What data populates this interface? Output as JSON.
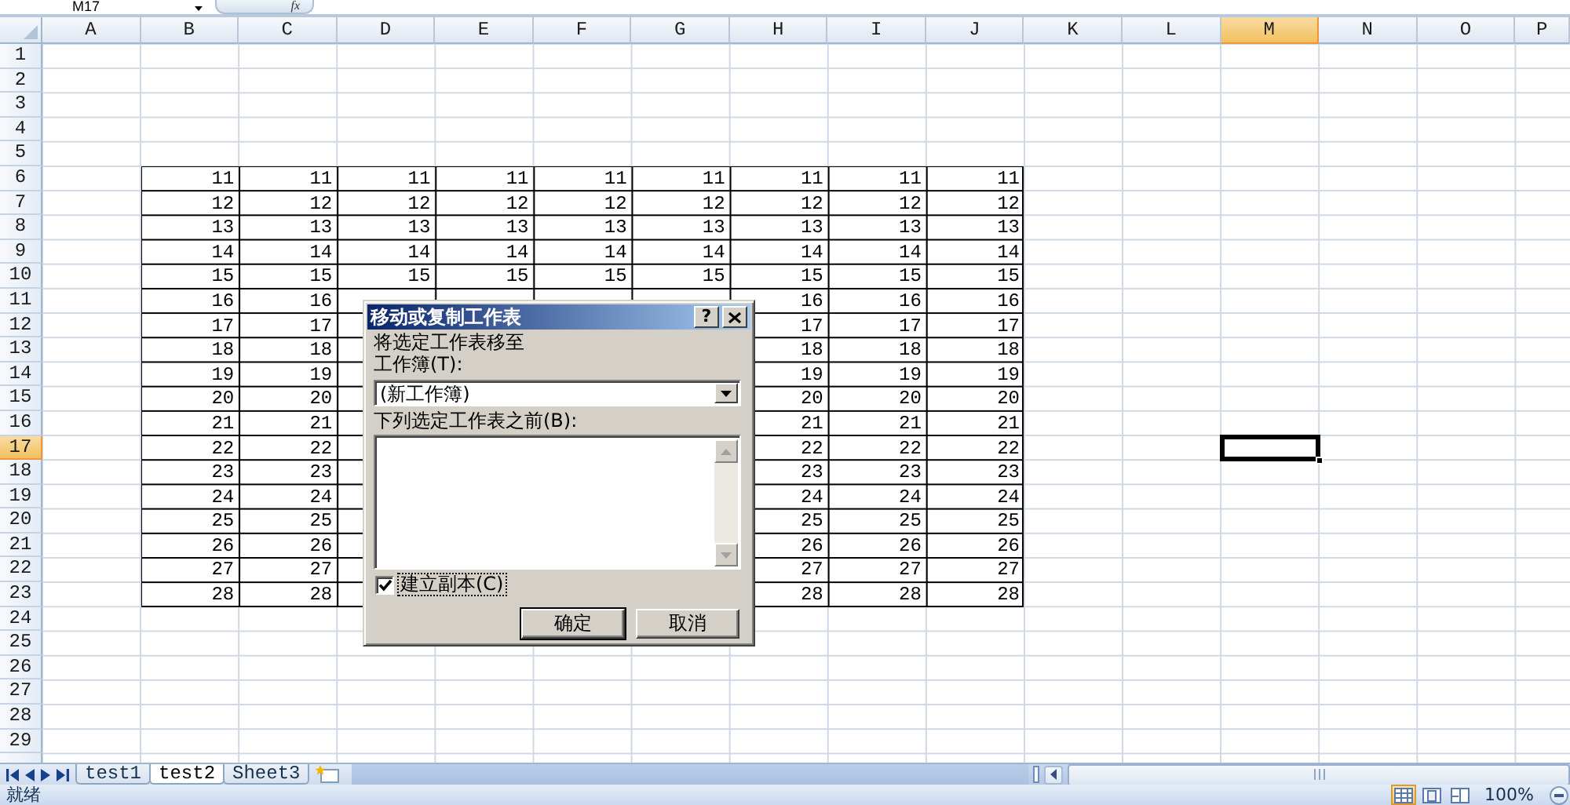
{
  "formula_bar": {
    "name_box": "M17",
    "function_button": "fx"
  },
  "sheet": {
    "columns": [
      {
        "label": "A",
        "selected": false
      },
      {
        "label": "B",
        "selected": false
      },
      {
        "label": "C",
        "selected": false
      },
      {
        "label": "D",
        "selected": false
      },
      {
        "label": "E",
        "selected": false
      },
      {
        "label": "F",
        "selected": false
      },
      {
        "label": "G",
        "selected": false
      },
      {
        "label": "H",
        "selected": false
      },
      {
        "label": "I",
        "selected": false
      },
      {
        "label": "J",
        "selected": false
      },
      {
        "label": "K",
        "selected": false
      },
      {
        "label": "L",
        "selected": false
      },
      {
        "label": "M",
        "selected": true
      },
      {
        "label": "N",
        "selected": false
      },
      {
        "label": "O",
        "selected": false
      },
      {
        "label": "P",
        "selected": false
      }
    ],
    "rows": [
      {
        "label": "1",
        "selected": false
      },
      {
        "label": "2",
        "selected": false
      },
      {
        "label": "3",
        "selected": false
      },
      {
        "label": "4",
        "selected": false
      },
      {
        "label": "5",
        "selected": false
      },
      {
        "label": "6",
        "selected": false,
        "values": [
          "11",
          "11",
          "11",
          "11",
          "11",
          "11",
          "11",
          "11",
          "11"
        ]
      },
      {
        "label": "7",
        "selected": false,
        "values": [
          "12",
          "12",
          "12",
          "12",
          "12",
          "12",
          "12",
          "12",
          "12"
        ]
      },
      {
        "label": "8",
        "selected": false,
        "values": [
          "13",
          "13",
          "13",
          "13",
          "13",
          "13",
          "13",
          "13",
          "13"
        ]
      },
      {
        "label": "9",
        "selected": false,
        "values": [
          "14",
          "14",
          "14",
          "14",
          "14",
          "14",
          "14",
          "14",
          "14"
        ]
      },
      {
        "label": "10",
        "selected": false,
        "values": [
          "15",
          "15",
          "15",
          "15",
          "15",
          "15",
          "15",
          "15",
          "15"
        ]
      },
      {
        "label": "11",
        "selected": false,
        "values": [
          "16",
          "16"
        ],
        "right_values": [
          "16",
          "16",
          "16"
        ]
      },
      {
        "label": "12",
        "selected": false,
        "values": [
          "17",
          "17"
        ],
        "right_values": [
          "17",
          "17",
          "17"
        ]
      },
      {
        "label": "13",
        "selected": false,
        "values": [
          "18",
          "18"
        ],
        "right_values": [
          "18",
          "18",
          "18"
        ]
      },
      {
        "label": "14",
        "selected": false,
        "values": [
          "19",
          "19"
        ],
        "right_values": [
          "19",
          "19",
          "19"
        ]
      },
      {
        "label": "15",
        "selected": false,
        "values": [
          "20",
          "20"
        ],
        "right_values": [
          "20",
          "20",
          "20"
        ]
      },
      {
        "label": "16",
        "selected": false,
        "values": [
          "21",
          "21"
        ],
        "right_values": [
          "21",
          "21",
          "21"
        ]
      },
      {
        "label": "17",
        "selected": true,
        "values": [
          "22",
          "22"
        ],
        "right_values": [
          "22",
          "22",
          "22"
        ]
      },
      {
        "label": "18",
        "selected": false,
        "values": [
          "23",
          "23"
        ],
        "right_values": [
          "23",
          "23",
          "23"
        ]
      },
      {
        "label": "19",
        "selected": false,
        "values": [
          "24",
          "24"
        ],
        "right_values": [
          "24",
          "24",
          "24"
        ]
      },
      {
        "label": "20",
        "selected": false,
        "values": [
          "25",
          "25"
        ],
        "right_values": [
          "25",
          "25",
          "25"
        ]
      },
      {
        "label": "21",
        "selected": false,
        "values": [
          "26",
          "26"
        ],
        "right_values": [
          "26",
          "26",
          "26"
        ]
      },
      {
        "label": "22",
        "selected": false,
        "values": [
          "27",
          "27"
        ],
        "right_values": [
          "27",
          "27",
          "27"
        ]
      },
      {
        "label": "23",
        "selected": false,
        "values": [
          "28",
          "28"
        ],
        "right_values": [
          "28",
          "28",
          "28"
        ]
      },
      {
        "label": "24",
        "selected": false
      },
      {
        "label": "25",
        "selected": false
      },
      {
        "label": "26",
        "selected": false
      },
      {
        "label": "27",
        "selected": false
      },
      {
        "label": "28",
        "selected": false
      },
      {
        "label": "29",
        "selected": false
      }
    ]
  },
  "dialog": {
    "title": "移动或复制工作表",
    "help_button": "?",
    "prompt": "将选定工作表移至",
    "workbook_label": "工作簿(T):",
    "workbook_value": "(新工作簿)",
    "before_label": "下列选定工作表之前(B):",
    "copy_checkbox": {
      "label": "建立副本(C)",
      "checked": true
    },
    "buttons": [
      {
        "label": "确定",
        "default": true
      },
      {
        "label": "取消",
        "default": false
      }
    ]
  },
  "sheet_tabs": [
    {
      "label": "test1",
      "selected": false
    },
    {
      "label": "test2",
      "selected": true
    },
    {
      "label": "Sheet3",
      "selected": false
    }
  ],
  "status_bar": {
    "status": "就绪",
    "views": [
      {
        "kind": "normal",
        "selected": true
      },
      {
        "kind": "layout",
        "selected": false
      },
      {
        "kind": "break",
        "selected": false
      }
    ],
    "zoom": "100%"
  }
}
